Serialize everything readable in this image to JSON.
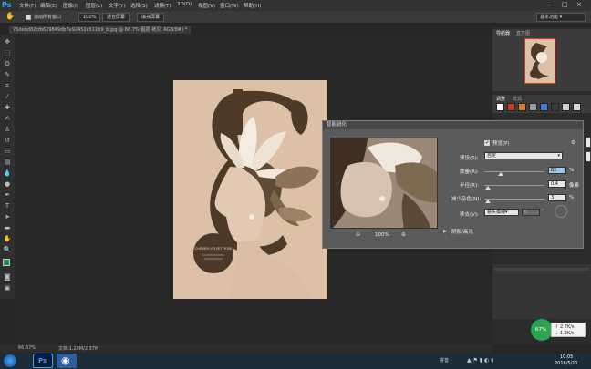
{
  "app": {
    "logo": "Ps"
  },
  "menu": [
    "文件(F)",
    "编辑(E)",
    "图像(I)",
    "图层(L)",
    "文字(Y)",
    "选择(S)",
    "滤镜(T)",
    "3D(D)",
    "视图(V)",
    "窗口(W)",
    "帮助(H)"
  ],
  "options": {
    "scroll_all_label": "滚动所有窗口",
    "zoom_100": "100%",
    "fit_screen": "适合屏幕",
    "fill_screen": "填充屏幕",
    "workspace": "基本功能"
  },
  "document": {
    "tab_title": "75debd82cfb629849db7e92452e511b9_b.jpg @ 66.7%(图层 拷贝, RGB/8#) *",
    "zoom": "66.67%",
    "doc_size": "文档:1.29M/2.37M",
    "poster_text": "CHERIEH VELVET ROSE"
  },
  "panels": {
    "navigator_tabs": [
      "导航器",
      "直方图"
    ],
    "adjust_tabs": [
      "调整",
      "样式"
    ],
    "swatches_colors": [
      "#ffffff",
      "#c53b2b",
      "#d9792c",
      "#9a9a9a",
      "#4a7bd0",
      "#3c3c3c",
      "#cfcfcf",
      "#d7d7d7"
    ]
  },
  "dialog": {
    "title": "智能锐化",
    "preview_checkbox": "预览(P)",
    "preset_label": "预设(S):",
    "preset_value": "自定",
    "amount_label": "数量(A):",
    "amount_value": "85",
    "amount_unit": "%",
    "radius_label": "半径(R):",
    "radius_value": "0.4",
    "radius_unit": "像素",
    "noise_label": "减少杂色(N):",
    "noise_value": "3",
    "noise_unit": "%",
    "remove_label": "移去(V):",
    "remove_value": "镜头模糊",
    "angle_value": "0",
    "zoom_value": "100%",
    "shadows_label": "阴影/高光",
    "ok_label": "确定",
    "cancel_label": "取消"
  },
  "taskbar": {
    "lang": "拼音",
    "time": "10:05",
    "date": "2016/5/11",
    "cpu_percent": "67%",
    "net_up": "2.7K/s",
    "net_down": "1.2K/s"
  }
}
